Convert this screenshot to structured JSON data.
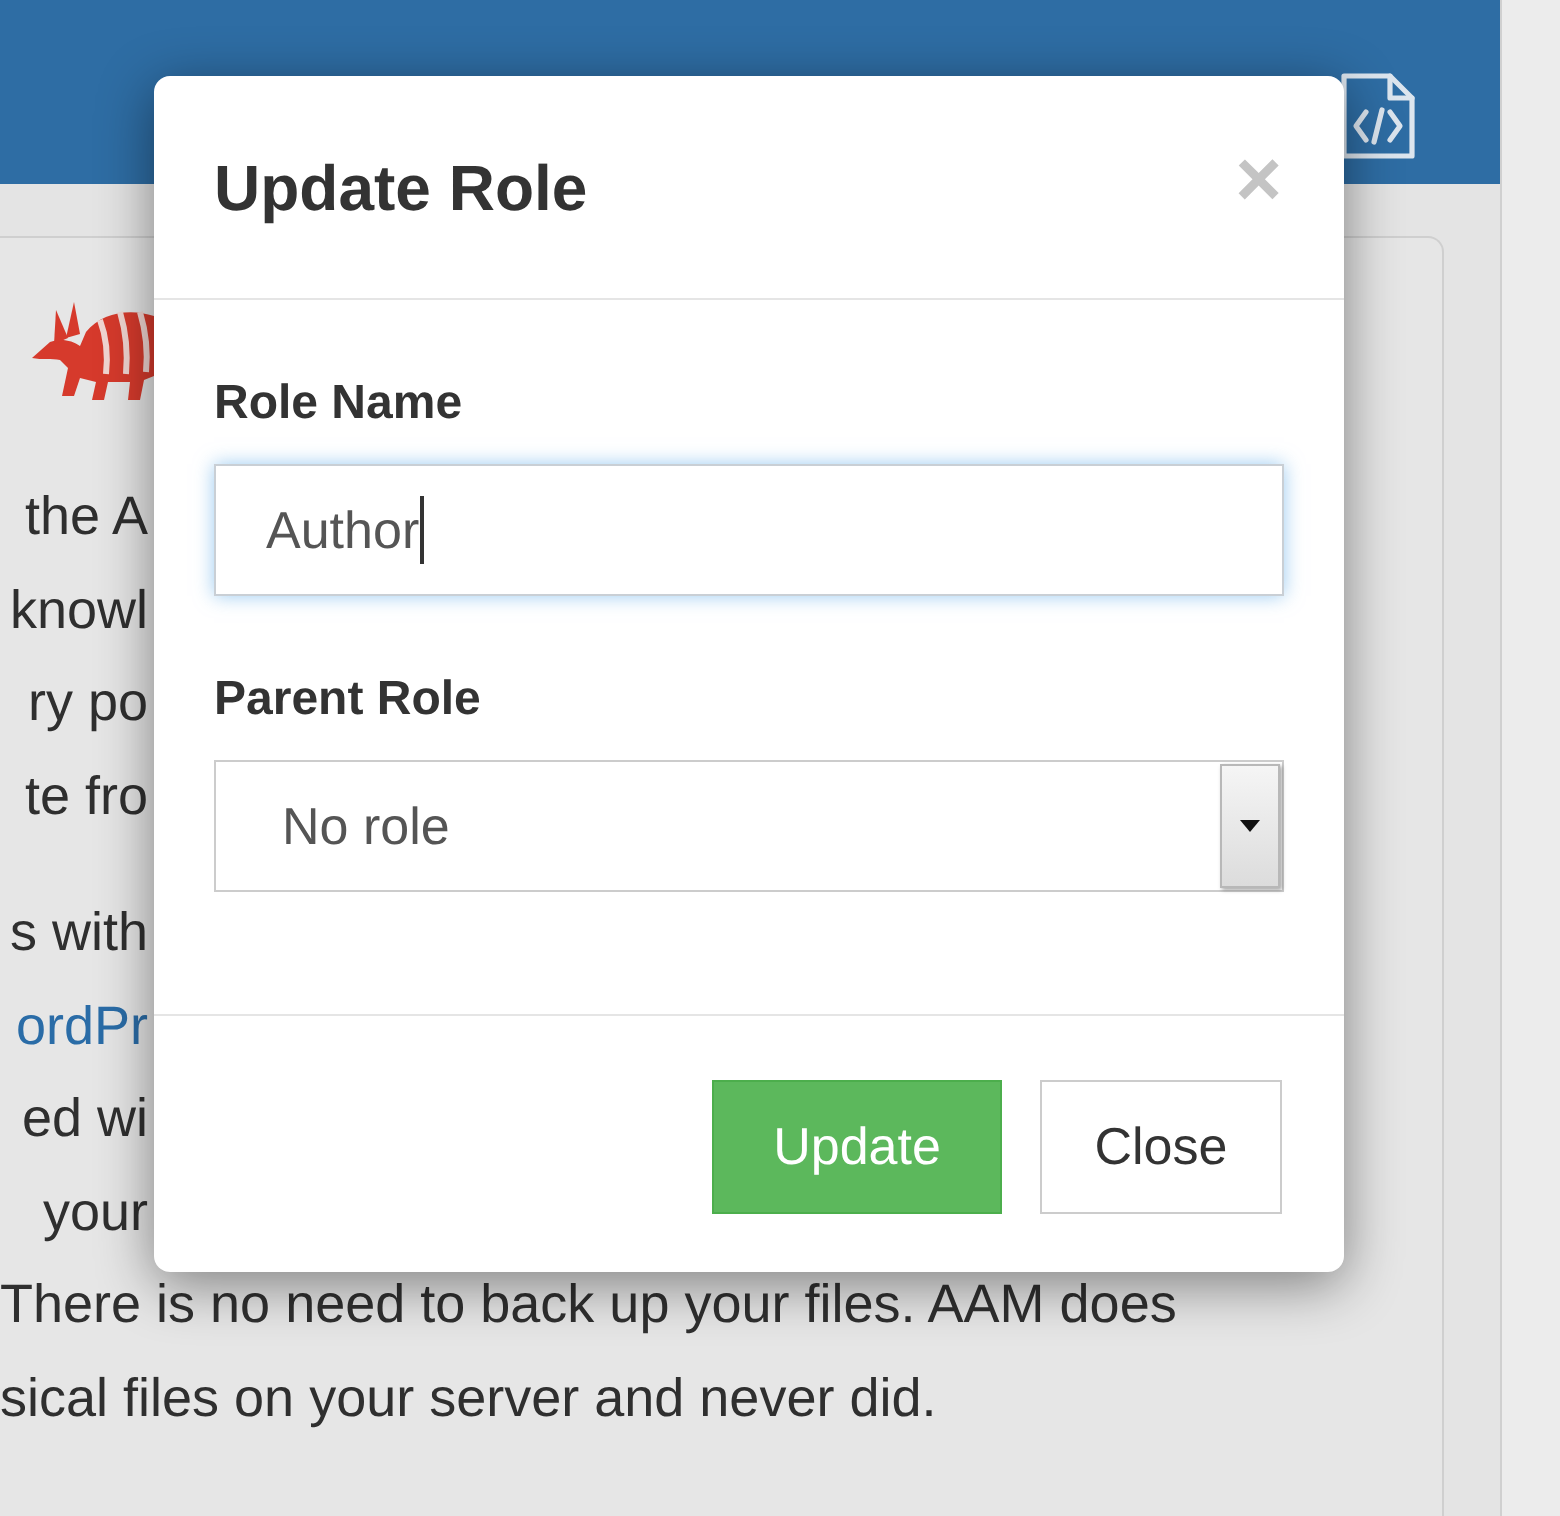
{
  "page": {
    "paragraphs": [
      {
        "lines": [
          {
            "text": "the A",
            "kind": "partial",
            "link": false
          },
          {
            "text": "knowl",
            "kind": "partial",
            "link": false
          },
          {
            "text": "ry po",
            "kind": "partial",
            "link": false
          },
          {
            "text": "te fro",
            "kind": "partial",
            "link": false
          }
        ]
      },
      {
        "lines": [
          {
            "text": "s with",
            "kind": "partial",
            "link": false
          },
          {
            "text": "ordPr",
            "kind": "partial",
            "link": true
          },
          {
            "text": "ed wi",
            "kind": "partial",
            "link": false
          },
          {
            "text": "your",
            "kind": "partial",
            "link": false
          },
          {
            "text": "There is no need to back up your files. AAM does",
            "kind": "full",
            "link": false
          },
          {
            "text": "sical files on your server and never did.",
            "kind": "full",
            "link": false
          }
        ]
      }
    ]
  },
  "dialog": {
    "title": "Update Role",
    "close_label": "×",
    "fields": [
      {
        "kind": "text",
        "label": "Role Name",
        "value": "Author",
        "focused": true
      },
      {
        "kind": "select",
        "label": "Parent Role",
        "value": "No role",
        "focused": false
      }
    ],
    "buttons": [
      {
        "label": "Update",
        "kind": "primary"
      },
      {
        "label": "Close",
        "kind": "default"
      }
    ]
  }
}
